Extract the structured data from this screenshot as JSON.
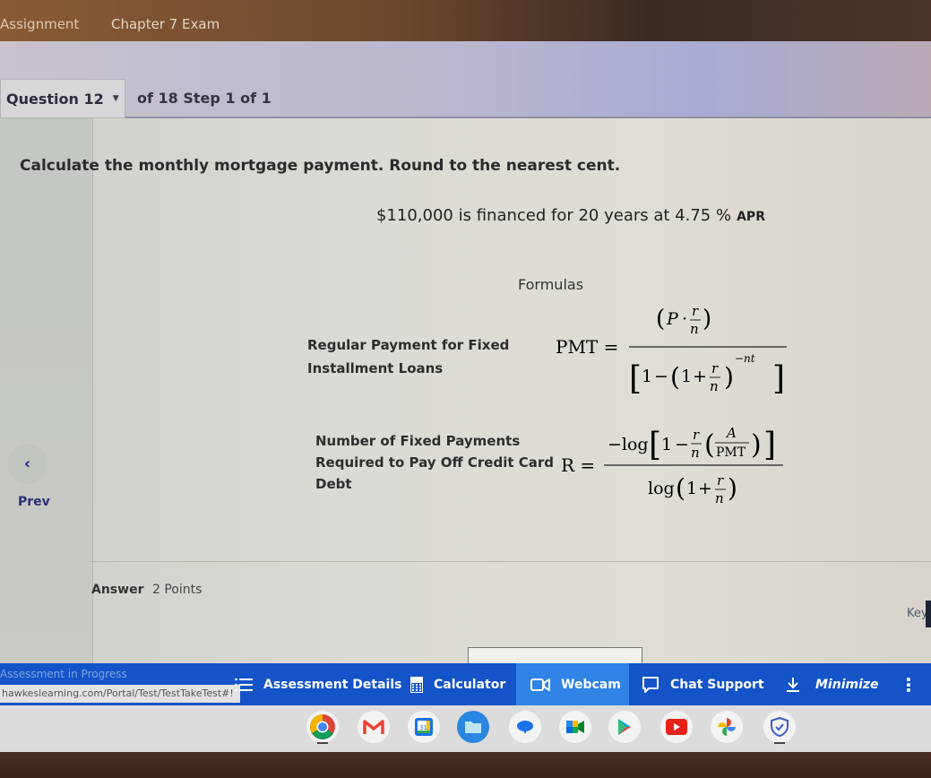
{
  "header": {
    "assignment_label": "Assignment",
    "exam_title": "Chapter 7 Exam"
  },
  "question_nav": {
    "question_select": "Question 12",
    "count_text": "of 18 Step 1 of 1"
  },
  "question": {
    "prompt": "Calculate the monthly mortgage payment. Round to the nearest cent.",
    "given_main": "$110,000 is financed for 20 years at 4.75 %",
    "given_unit": "APR"
  },
  "formulas": {
    "title": "Formulas",
    "items": [
      {
        "label_line1": "Regular Payment for Fixed",
        "label_line2": "Installment Loans",
        "lhs": "PMT =",
        "numerator": "(P · r/n)",
        "denominator": "[1 − (1 + r/n)^(−nt)]"
      },
      {
        "label_line1": "Number of Fixed Payments",
        "label_line2": "Required to Pay Off Credit Card",
        "label_line3": "Debt",
        "lhs": "R =",
        "numerator": "−log[1 − (r/n)(A/PMT)]",
        "denominator": "log(1 + r/n)"
      }
    ]
  },
  "nav": {
    "prev_label": "Prev",
    "prev_glyph": "‹"
  },
  "answer": {
    "label": "Answer",
    "points": "2 Points",
    "keypad_hint": "Key"
  },
  "toolbar": {
    "status_text": "Assessment in Progress",
    "url_text": "hawkeslearning.com/Portal/Test/TestTakeTest#!",
    "items": [
      {
        "label": "Assessment Details",
        "icon": "list-icon"
      },
      {
        "label": "Calculator",
        "icon": "calculator-icon"
      },
      {
        "label": "Webcam",
        "icon": "webcam-icon"
      },
      {
        "label": "Chat Support",
        "icon": "chat-icon"
      },
      {
        "label": "Minimize",
        "icon": "download-arrow-icon"
      }
    ],
    "more_glyph": "⋮",
    "colors": {
      "bar": "#1454c8",
      "active": "#2f84e6"
    }
  },
  "shelf": {
    "apps": [
      "Chrome",
      "Gmail",
      "Calendar",
      "Files",
      "Messages",
      "Meet",
      "Play Store",
      "YouTube",
      "Photos",
      "Security"
    ],
    "calendar_day": "31"
  }
}
